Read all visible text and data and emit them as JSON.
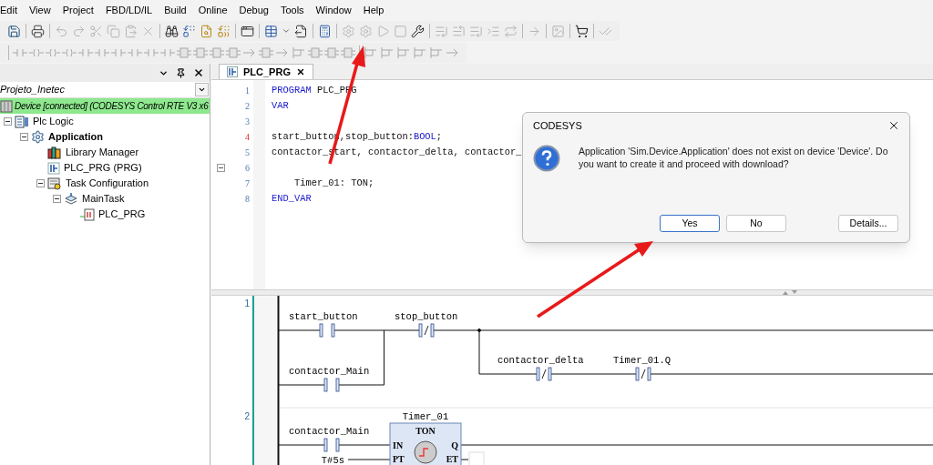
{
  "menu": [
    "Edit",
    "View",
    "Project",
    "FBD/LD/IL",
    "Build",
    "Online",
    "Debug",
    "Tools",
    "Window",
    "Help"
  ],
  "toolbar_rows": [
    [
      {
        "kind": "save",
        "disabled": false
      },
      {
        "kind": "separator"
      },
      {
        "kind": "print",
        "disabled": false
      },
      {
        "kind": "separator"
      },
      {
        "kind": "undo",
        "disabled": true
      },
      {
        "kind": "redo",
        "disabled": true
      },
      {
        "kind": "cut",
        "disabled": true
      },
      {
        "kind": "copy",
        "disabled": true
      },
      {
        "kind": "paste",
        "disabled": true
      },
      {
        "kind": "delete",
        "disabled": true
      },
      {
        "kind": "separator"
      },
      {
        "kind": "find",
        "disabled": false
      },
      {
        "kind": "replace",
        "disabled": false
      },
      {
        "kind": "find-files",
        "disabled": false
      },
      {
        "kind": "replace-files",
        "disabled": false
      },
      {
        "kind": "separator"
      },
      {
        "kind": "windows",
        "disabled": false
      },
      {
        "kind": "separator"
      },
      {
        "kind": "table",
        "disabled": false
      },
      {
        "kind": "caret",
        "disabled": false
      },
      {
        "kind": "document",
        "disabled": false
      },
      {
        "kind": "separator"
      },
      {
        "kind": "calculator",
        "disabled": false
      },
      {
        "kind": "separator"
      },
      {
        "kind": "login",
        "disabled": true
      },
      {
        "kind": "logout",
        "disabled": true
      },
      {
        "kind": "start",
        "disabled": true
      },
      {
        "kind": "stop",
        "disabled": true
      },
      {
        "kind": "wrench",
        "disabled": false
      },
      {
        "kind": "separator"
      },
      {
        "kind": "step-list",
        "disabled": true
      },
      {
        "kind": "step-into",
        "disabled": true
      },
      {
        "kind": "step-out",
        "disabled": true
      },
      {
        "kind": "indent",
        "disabled": true
      },
      {
        "kind": "cycle",
        "disabled": true
      },
      {
        "kind": "separator"
      },
      {
        "kind": "arrow",
        "disabled": true
      },
      {
        "kind": "separator"
      },
      {
        "kind": "image",
        "disabled": true
      },
      {
        "kind": "separator"
      },
      {
        "kind": "cart",
        "disabled": false
      },
      {
        "kind": "separator"
      },
      {
        "kind": "check",
        "disabled": true
      }
    ],
    [
      {
        "kind": "separator"
      },
      {
        "kind": "contact",
        "disabled": true
      },
      {
        "kind": "coil",
        "disabled": true
      },
      {
        "kind": "coil",
        "disabled": true
      },
      {
        "kind": "coil",
        "disabled": true
      },
      {
        "kind": "contact",
        "disabled": true
      },
      {
        "kind": "contact",
        "disabled": true
      },
      {
        "kind": "contact",
        "disabled": true
      },
      {
        "kind": "contact",
        "disabled": true
      },
      {
        "kind": "contact",
        "disabled": true
      },
      {
        "kind": "contact",
        "disabled": true
      },
      {
        "kind": "block",
        "disabled": true
      },
      {
        "kind": "block",
        "disabled": true
      },
      {
        "kind": "block",
        "disabled": true
      },
      {
        "kind": "block",
        "disabled": true
      },
      {
        "kind": "arrow",
        "disabled": true
      },
      {
        "kind": "block",
        "disabled": true
      },
      {
        "kind": "arrow",
        "disabled": true
      },
      {
        "kind": "branch",
        "disabled": true
      },
      {
        "kind": "block",
        "disabled": true
      },
      {
        "kind": "block",
        "disabled": true
      },
      {
        "kind": "block",
        "disabled": true
      },
      {
        "kind": "separator"
      },
      {
        "kind": "branch",
        "disabled": true
      },
      {
        "kind": "branch",
        "disabled": true
      },
      {
        "kind": "branch",
        "disabled": true
      },
      {
        "kind": "branch",
        "disabled": true
      },
      {
        "kind": "branch",
        "disabled": true
      },
      {
        "kind": "arrow",
        "disabled": true
      }
    ]
  ],
  "devices_panel": {
    "project": "Projeto_Inetec",
    "device": {
      "label": "Device [connected] (CODESYS Control RTE V3 x6",
      "highlighted": true,
      "children": [
        {
          "label": "Plc Logic",
          "kind": "plc-logic",
          "bold": false,
          "expanded": true,
          "children": [
            {
              "label": "Application",
              "kind": "application",
              "bold": true,
              "expanded": true,
              "children": [
                {
                  "label": "Library Manager",
                  "kind": "library",
                  "bold": false
                },
                {
                  "label": "PLC_PRG (PRG)",
                  "kind": "pou",
                  "bold": false
                },
                {
                  "label": "Task Configuration",
                  "kind": "task-config",
                  "bold": false,
                  "expanded": true,
                  "children": [
                    {
                      "label": "MainTask",
                      "kind": "task",
                      "bold": false,
                      "expanded": true,
                      "children": [
                        {
                          "label": "PLC_PRG",
                          "kind": "program-call",
                          "bold": false
                        }
                      ]
                    }
                  ]
                }
              ]
            }
          ]
        }
      ]
    }
  },
  "editor": {
    "tabs": [
      {
        "label": "PLC_PRG",
        "selected": true
      }
    ],
    "lines": [
      {
        "number": "1",
        "changed": false,
        "fold_marker": false,
        "segments": [
          {
            "text": "PROGRAM",
            "kind": "keyword"
          },
          {
            "text": " PLC_PRG",
            "kind": "plain"
          }
        ]
      },
      {
        "number": "2",
        "changed": false,
        "fold_marker": false,
        "segments": [
          {
            "text": "VAR",
            "kind": "keyword"
          }
        ]
      },
      {
        "number": "3",
        "changed": false,
        "fold_marker": false
      },
      {
        "number": "4",
        "changed": true,
        "fold_marker": false,
        "segments": [
          {
            "text": "start_button,stop_button:",
            "kind": "plain"
          },
          {
            "text": "BOOL",
            "kind": "keyword"
          },
          {
            "text": ";",
            "kind": "plain"
          }
        ]
      },
      {
        "number": "5",
        "changed": false,
        "fold_marker": false,
        "segments": [
          {
            "text": "contactor_start, contactor_delta, contactor_",
            "kind": "plain"
          }
        ]
      },
      {
        "number": "6",
        "changed": false,
        "fold_marker": true
      },
      {
        "number": "7",
        "changed": false,
        "fold_marker": false,
        "segments": [
          {
            "text": "    Timer_01: TON;",
            "kind": "plain"
          }
        ]
      },
      {
        "number": "8",
        "changed": false,
        "fold_marker": false,
        "segments": [
          {
            "text": "END_VAR",
            "kind": "keyword"
          }
        ]
      }
    ]
  },
  "ladder": {
    "networks": [
      {
        "number": "1",
        "contacts": [
          {
            "label": "start_button",
            "negated": false
          },
          {
            "label": "stop_button",
            "negated": true
          },
          {
            "label": "contactor_Main",
            "negated": false
          },
          {
            "label": "contactor_delta",
            "negated": true
          },
          {
            "label": "Timer_01.Q",
            "negated": true
          }
        ]
      },
      {
        "number": "2",
        "contacts": [
          {
            "label": "contactor_Main",
            "negated": false
          }
        ],
        "block": {
          "instance": "Timer_01",
          "type": "TON",
          "inputs": [
            "IN",
            "PT"
          ],
          "outputs": [
            "Q",
            "ET"
          ],
          "pt_value": "T#5s"
        }
      }
    ]
  },
  "dialog": {
    "title": "CODESYS",
    "message": "Application 'Sim.Device.Application' does not exist on device 'Device'. Do you want to create it and proceed with download?",
    "buttons": [
      {
        "label": "Yes",
        "selected": true
      },
      {
        "label": "No",
        "selected": false
      },
      {
        "label": "Details...",
        "selected": false
      }
    ]
  }
}
